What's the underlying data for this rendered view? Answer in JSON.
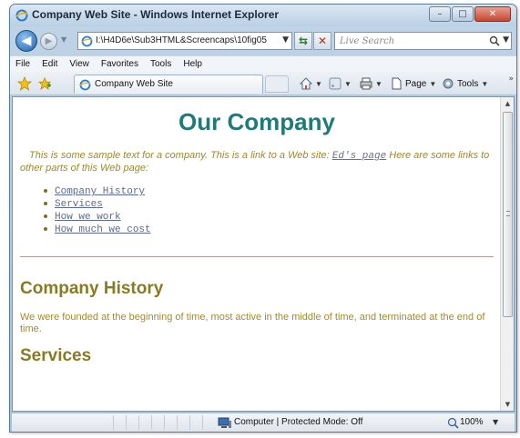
{
  "window": {
    "title": "Company Web Site - Windows Internet Explorer",
    "minimize_label": "▭",
    "maximize_label": "□",
    "close_label": "X"
  },
  "address_bar": {
    "url": "I:\\H4D6e\\Sub3HTML&Screencaps\\10fig05"
  },
  "search": {
    "placeholder": "Live Search"
  },
  "menu": [
    "File",
    "Edit",
    "View",
    "Favorites",
    "Tools",
    "Help"
  ],
  "tab": {
    "label": "Company Web Site"
  },
  "command_bar": {
    "page_label": "Page",
    "tools_label": "Tools"
  },
  "page": {
    "heading": "Our Company",
    "intro_before": "This is some sample text for a company. This is a link to a Web site: ",
    "intro_link": "Ed's page",
    "intro_after": " Here are some links to other parts of this Web page:",
    "links": [
      "Company History",
      "Services",
      "How we work",
      "How much we cost"
    ],
    "section1_heading": "Company History",
    "section1_text": "We were founded at the beginning of time, most active in the middle of time, and terminated at the end of time.",
    "section2_heading": "Services"
  },
  "status": {
    "zone_text": "Computer | Protected Mode: Off",
    "zoom": "100%"
  },
  "colors": {
    "heading": "#1f7b79",
    "body_text": "#9a8a2e",
    "section_heading": "#8a7a22",
    "link": "#5b6a8c"
  }
}
